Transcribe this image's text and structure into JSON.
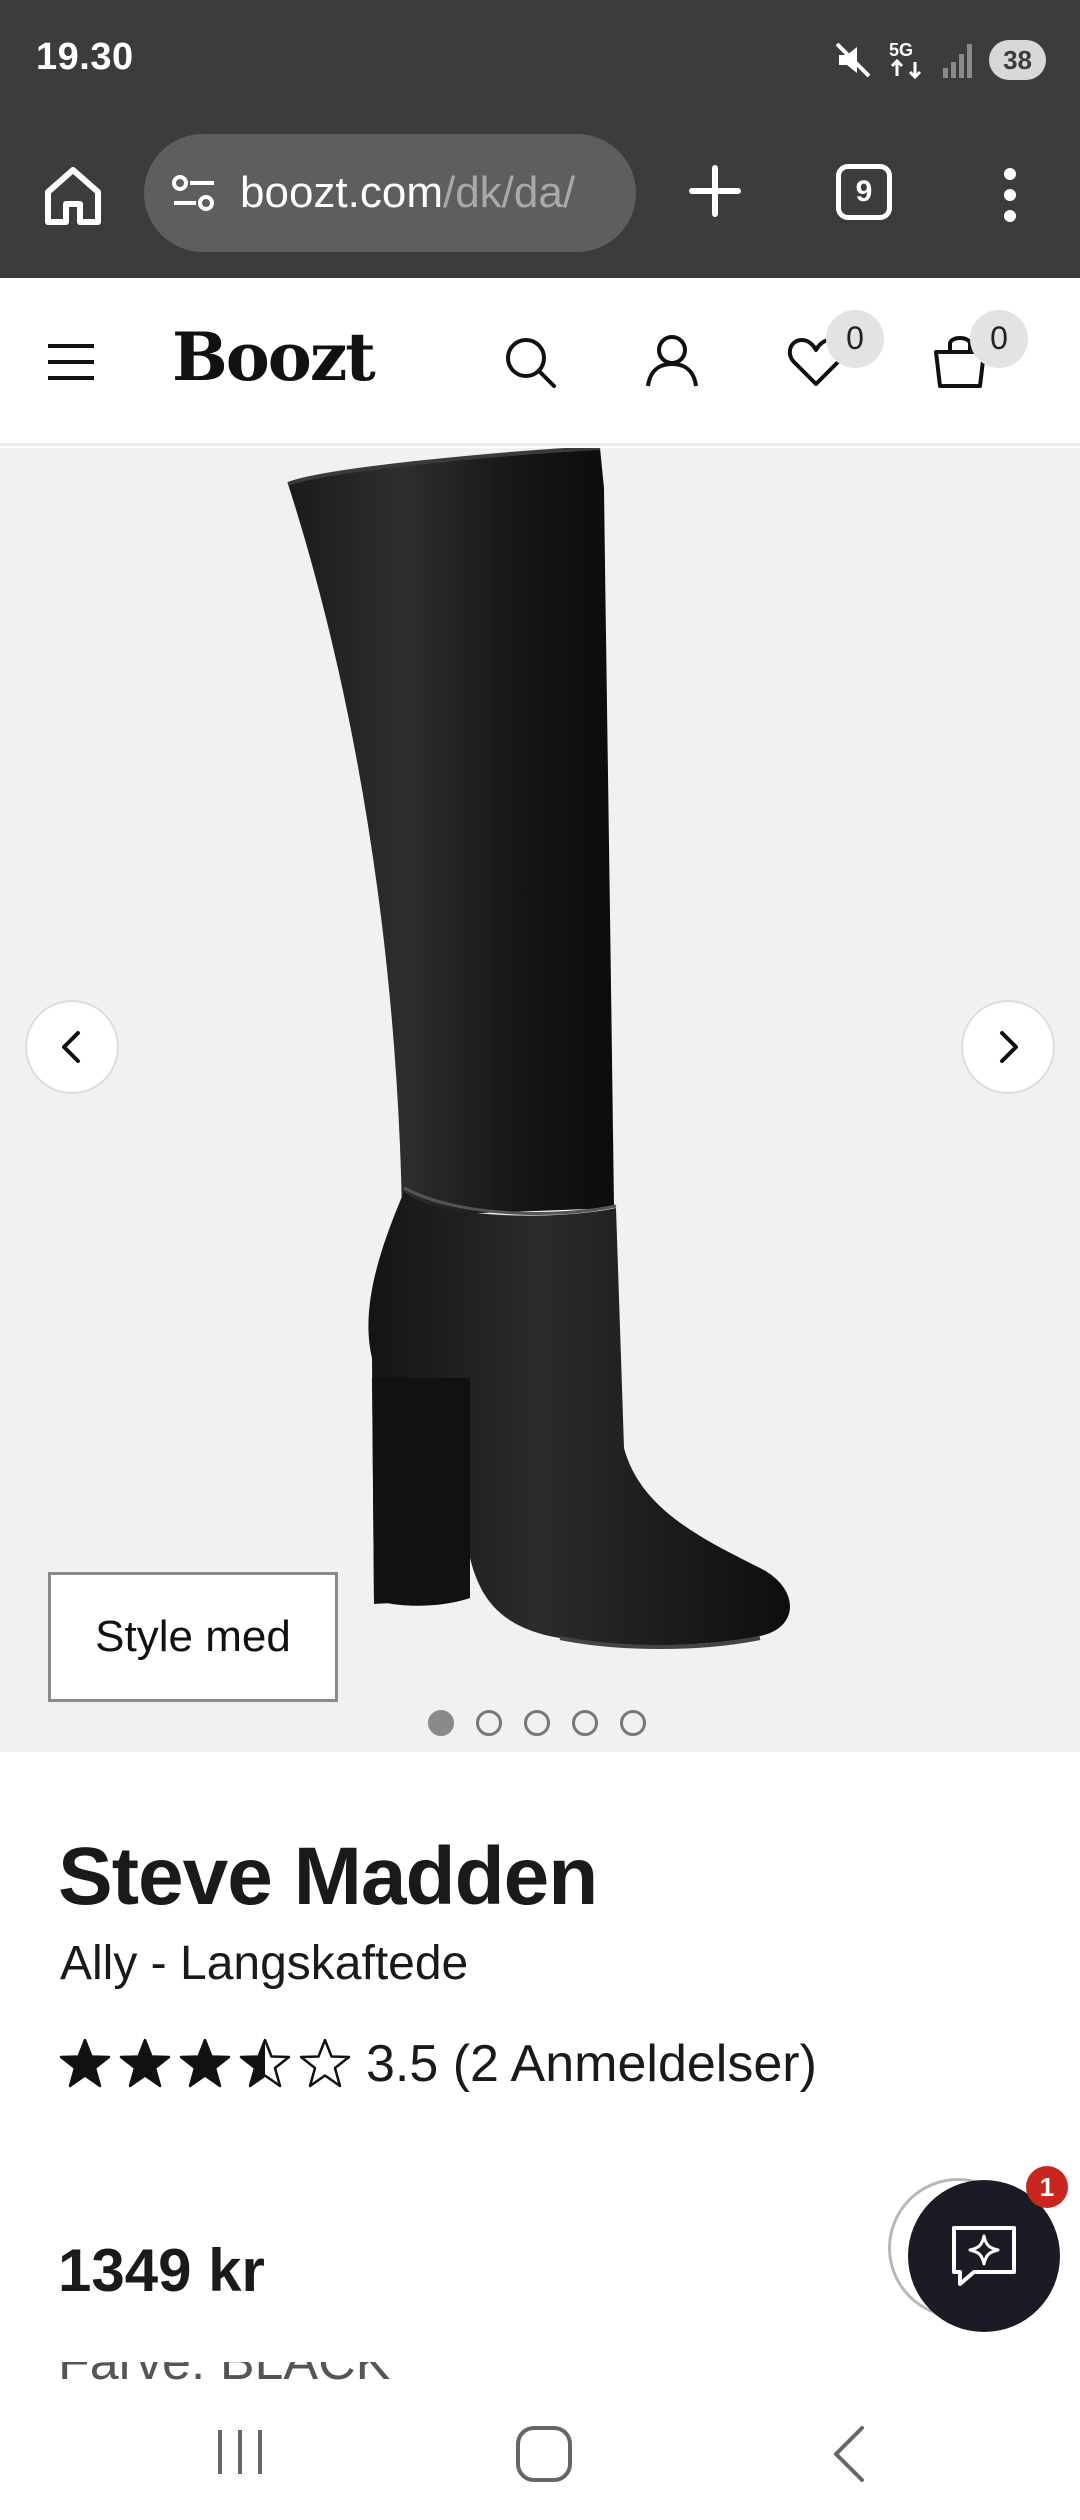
{
  "status_bar": {
    "time": "19.30",
    "network": "5G",
    "battery": "38",
    "icons": [
      "mute-icon",
      "5g-data-icon",
      "signal-icon",
      "battery-icon"
    ]
  },
  "browser": {
    "url_domain": "boozt.com",
    "url_path": "/dk/da/",
    "tab_count": "9",
    "icons": [
      "home-icon",
      "site-settings-icon",
      "new-tab-icon",
      "tabs-icon",
      "more-menu-icon"
    ]
  },
  "site_header": {
    "logo": "Boozt",
    "wishlist_count": "0",
    "cart_count": "0",
    "icons": [
      "menu-icon",
      "search-icon",
      "account-icon",
      "heart-icon",
      "bag-icon"
    ]
  },
  "gallery": {
    "style_button": "Style med",
    "image_count": 5,
    "active_index": 0
  },
  "product": {
    "brand": "Steve Madden",
    "name": "Ally - Langskaftede",
    "rating_value": 3.5,
    "rating_text": "3.5 (2 Anmeldelser)",
    "price": "1349 kr",
    "color_label": "Farve: BLACK"
  },
  "chat": {
    "badge": "1"
  },
  "colors": {
    "chrome_bg": "#3c3c3c",
    "gallery_bg": "#f1f1f1",
    "chat_bg": "#1b1b26",
    "badge_red": "#c9261f"
  }
}
